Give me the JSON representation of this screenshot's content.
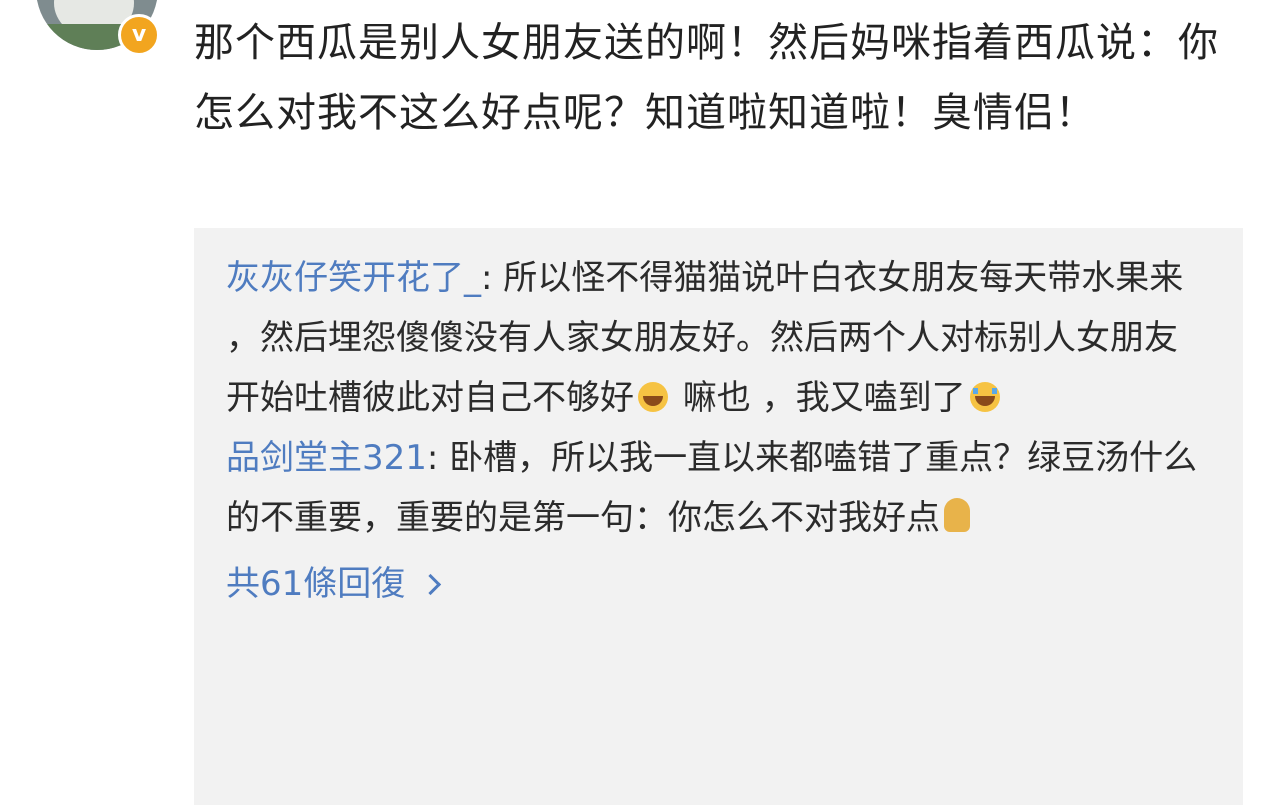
{
  "post": {
    "verified_badge": "v",
    "text": "那个西瓜是别人女朋友送的啊！然后妈咪指着西瓜说：你怎么对我不这么好点呢？知道啦知道啦！臭情侣！"
  },
  "replies": [
    {
      "user": "灰灰仔笑开花了_",
      "text_before": ": 所以怪不得猫猫说叶白衣女朋友每天带水果来 ，然后埋怨傻傻没有人家女朋友好。然后两个人对标别人女朋友开始吐槽彼此对自己不够好",
      "text_middle": " 嘛也 ，我又嗑到了",
      "emoji_1": "laugh-cry-emoji",
      "emoji_2": "crying-emoji"
    },
    {
      "user": "品剑堂主321",
      "text_before": ": 卧槽，所以我一直以来都嗑错了重点？绿豆汤什么的不重要，重要的是第一句：你怎么不对我好点",
      "emoji_1": "sleepy-emoji"
    }
  ],
  "more_replies_label": "共61條回復"
}
